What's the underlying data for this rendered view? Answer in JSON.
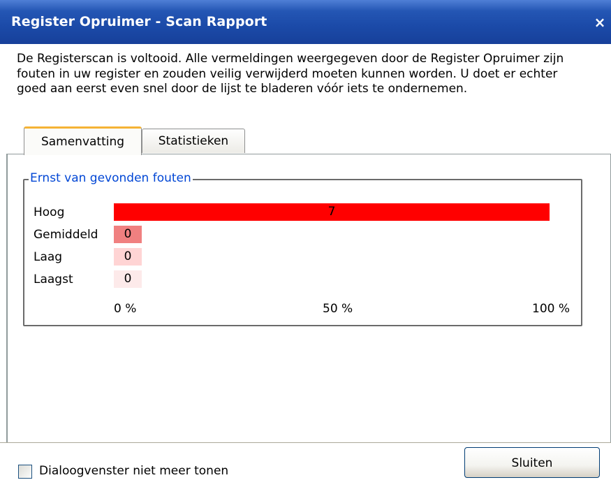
{
  "window": {
    "title": "Register Opruimer - Scan Rapport",
    "close_glyph": "×"
  },
  "intro_text": "De Registerscan is voltooid. Alle vermeldingen weergegeven door de Register Opruimer zijn fouten in uw register en zouden veilig verwijderd moeten kunnen worden. U doet er echter goed aan eerst even snel door de lijst te bladeren vóór iets te ondernemen.",
  "tabs": [
    {
      "label": "Samenvatting",
      "active": true
    },
    {
      "label": "Statistieken",
      "active": false
    }
  ],
  "severity": {
    "legend": "Ernst van gevonden fouten",
    "rows": [
      {
        "label": "Hoog",
        "count": "7",
        "percent": 100,
        "color": "#ff0000"
      },
      {
        "label": "Gemiddeld",
        "count": "0",
        "percent": 0,
        "color": "#f08080"
      },
      {
        "label": "Laag",
        "count": "0",
        "percent": 0,
        "color": "#ffd4d4"
      },
      {
        "label": "Laagst",
        "count": "0",
        "percent": 0,
        "color": "#fdeaea"
      }
    ],
    "axis": [
      "0 %",
      "50 %",
      "100 %"
    ]
  },
  "footer": {
    "checkbox_label": "Dialoogvenster niet meer tonen",
    "checkbox_checked": false,
    "close_button_label": "Sluiten"
  }
}
